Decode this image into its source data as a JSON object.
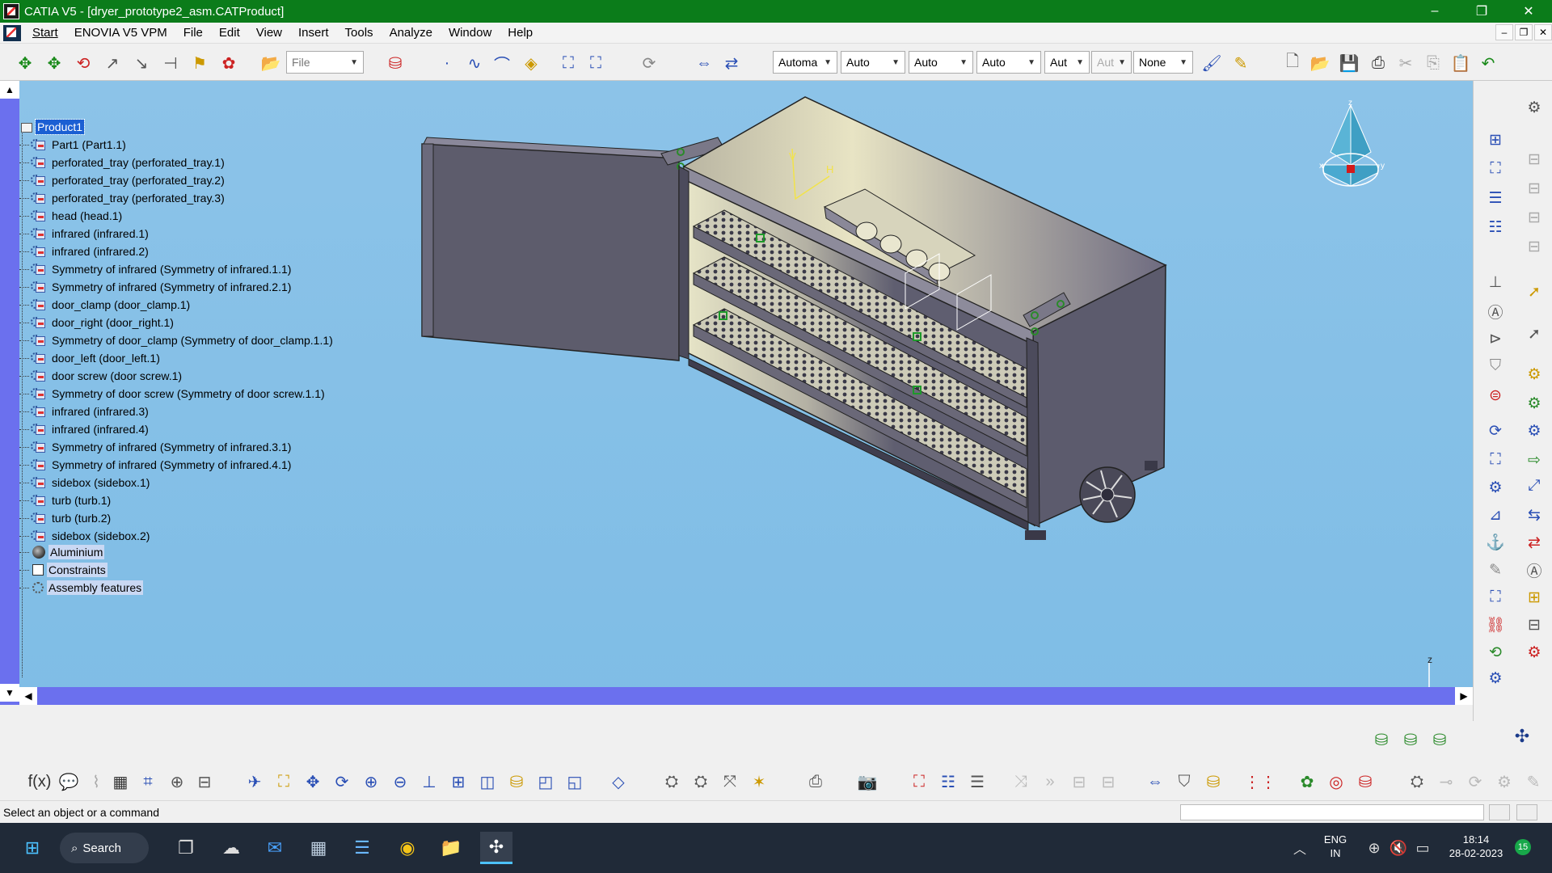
{
  "window": {
    "title": "CATIA V5 - [dryer_prototype2_asm.CATProduct]",
    "controls": [
      "–",
      "❐",
      "✕"
    ]
  },
  "menu": {
    "items": [
      "Start",
      "ENOVIA V5 VPM",
      "File",
      "Edit",
      "View",
      "Insert",
      "Tools",
      "Analyze",
      "Window",
      "Help"
    ],
    "doc_controls": [
      "–",
      "❐",
      "✕"
    ]
  },
  "toolbar": {
    "file_combo": "File",
    "combos": [
      "Automa",
      "Auto",
      "Auto",
      "Auto",
      "Aut",
      "Aut",
      "None"
    ]
  },
  "tree": {
    "root": "Product1",
    "items": [
      "Part1 (Part1.1)",
      "perforated_tray (perforated_tray.1)",
      "perforated_tray (perforated_tray.2)",
      "perforated_tray (perforated_tray.3)",
      "head (head.1)",
      "infrared (infrared.1)",
      "infrared (infrared.2)",
      "Symmetry of infrared (Symmetry of infrared.1.1)",
      "Symmetry of infrared (Symmetry of infrared.2.1)",
      "door_clamp (door_clamp.1)",
      "door_right (door_right.1)",
      "Symmetry of door_clamp (Symmetry of door_clamp.1.1)",
      "door_left (door_left.1)",
      "door screw (door screw.1)",
      "Symmetry of door screw (Symmetry of door screw.1.1)",
      "infrared (infrared.3)",
      "infrared (infrared.4)",
      "Symmetry of infrared (Symmetry of infrared.3.1)",
      "Symmetry of infrared (Symmetry of infrared.4.1)",
      "sidebox (sidebox.1)",
      "turb (turb.1)",
      "turb (turb.2)",
      "sidebox (sidebox.2)"
    ],
    "material": "Aluminium",
    "constraints": "Constraints",
    "assembly_features": "Assembly features"
  },
  "viewport": {
    "compass_labels": {
      "z": "z",
      "x": "x",
      "y": "y"
    },
    "axis_labels": {
      "z": "z",
      "x": "x",
      "y": "y"
    },
    "sketch_labels": {
      "v": "V",
      "h": "H"
    }
  },
  "status": {
    "message": "Select an object or a command"
  },
  "taskbar": {
    "search_label": "Search",
    "lang_line1": "ENG",
    "lang_line2": "IN",
    "time": "18:14",
    "date": "28-02-2023",
    "notification_count": "15"
  },
  "colors": {
    "title_bar": "#0b7c1a",
    "viewport_bg": "#7fbde6",
    "scrollbar": "#6b70ee",
    "selection": "#1b5fd3",
    "taskbar": "#202a38"
  }
}
